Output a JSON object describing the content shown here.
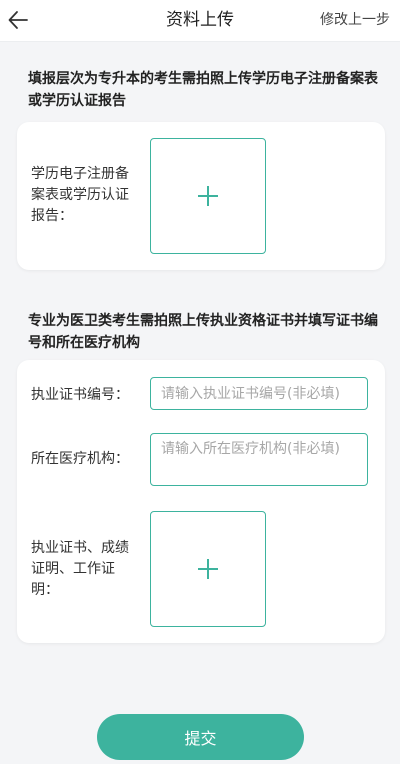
{
  "header": {
    "title": "资料上传",
    "right_action": "修改上一步",
    "back_icon": "arrow-left-icon"
  },
  "section1": {
    "description": "填报层次为专升本的考生需拍照上传学历电子注册备案表或学历认证报告",
    "field_label": "学历电子注册备案表或学历认证报告："
  },
  "section2": {
    "description": "专业为医卫类考生需拍照上传执业资格证书并填写证书编号和所在医疗机构",
    "cert_no_label": "执业证书编号：",
    "cert_no_placeholder": "请输入执业证书编号(非必填)",
    "institution_label": "所在医疗机构：",
    "institution_placeholder": "请输入所在医疗机构(非必填)",
    "upload_label": "执业证书、成绩证明、工作证明："
  },
  "submit_label": "提交",
  "colors": {
    "accent": "#3db39e",
    "background": "#f4f5f7"
  }
}
